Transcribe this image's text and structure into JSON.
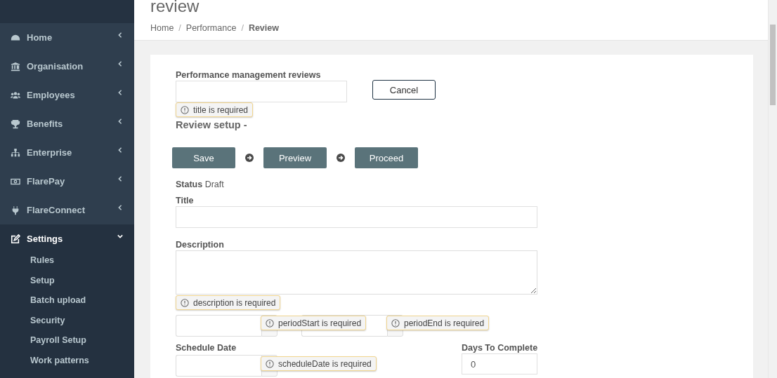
{
  "sidebar": {
    "items": [
      {
        "label": "Home",
        "expanded": false,
        "selected": false
      },
      {
        "label": "Organisation",
        "expanded": false,
        "selected": false
      },
      {
        "label": "Employees",
        "expanded": false,
        "selected": false
      },
      {
        "label": "Benefits",
        "expanded": false,
        "selected": false
      },
      {
        "label": "Enterprise",
        "expanded": false,
        "selected": false
      },
      {
        "label": "FlarePay",
        "expanded": false,
        "selected": false
      },
      {
        "label": "FlareConnect",
        "expanded": false,
        "selected": false
      },
      {
        "label": "Settings",
        "expanded": true,
        "selected": true,
        "children": [
          {
            "label": "Rules"
          },
          {
            "label": "Setup"
          },
          {
            "label": "Batch upload"
          },
          {
            "label": "Security"
          },
          {
            "label": "Payroll Setup"
          },
          {
            "label": "Work patterns"
          }
        ]
      }
    ]
  },
  "page": {
    "title": "review",
    "separator": "/",
    "breadcrumb": [
      {
        "label": "Home",
        "current": false
      },
      {
        "label": "Performance",
        "current": false
      },
      {
        "label": "Review",
        "current": true
      }
    ]
  },
  "form": {
    "reviews_label": "Performance management reviews",
    "reviews_error": "title is required",
    "cancel": "Cancel",
    "section_title": "Review setup -",
    "steps": [
      "Save",
      "Preview",
      "Proceed"
    ],
    "status_label": "Status",
    "status_value": "Draft",
    "title_label": "Title",
    "description_label": "Description",
    "description_error": "description is required",
    "period_start_error": "periodStart is required",
    "period_end_error": "periodEnd is required",
    "schedule_label": "Schedule Date",
    "schedule_error": "scheduleDate is required",
    "days_label": "Days To Complete",
    "days_value": "0"
  }
}
